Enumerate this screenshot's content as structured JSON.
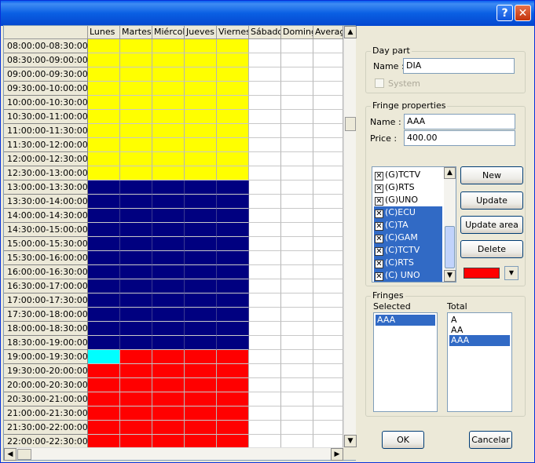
{
  "titlebar": {
    "help_glyph": "?",
    "close_glyph": "✕"
  },
  "grid": {
    "columns": [
      "Lunes",
      "Martes",
      "Miércol",
      "Jueves",
      "Viernes",
      "Sábado",
      "Doming",
      "Averag"
    ],
    "rows": [
      "08:00:00-08:30:00",
      "08:30:00-09:00:00",
      "09:00:00-09:30:00",
      "09:30:00-10:00:00",
      "10:00:00-10:30:00",
      "10:30:00-11:00:00",
      "11:00:00-11:30:00",
      "11:30:00-12:00:00",
      "12:00:00-12:30:00",
      "12:30:00-13:00:00",
      "13:00:00-13:30:00",
      "13:30:00-14:00:00",
      "14:00:00-14:30:00",
      "14:30:00-15:00:00",
      "15:00:00-15:30:00",
      "15:30:00-16:00:00",
      "16:00:00-16:30:00",
      "16:30:00-17:00:00",
      "17:00:00-17:30:00",
      "17:30:00-18:00:00",
      "18:00:00-18:30:00",
      "18:30:00-19:00:00",
      "19:00:00-19:30:00",
      "19:30:00-20:00:00",
      "20:00:00-20:30:00",
      "20:30:00-21:00:00",
      "21:00:00-21:30:00",
      "21:30:00-22:00:00",
      "22:00:00-22:30:00"
    ],
    "bands": [
      {
        "from": 0,
        "to": 9,
        "color": "#ffff00"
      },
      {
        "from": 10,
        "to": 21,
        "color": "#000080"
      },
      {
        "from": 22,
        "to": 28,
        "color": "#ff0000"
      }
    ],
    "colored_days": 5,
    "special_cell": {
      "row": 22,
      "col": 0,
      "color": "#00ffff"
    },
    "scroll_up": "▲",
    "scroll_down": "▼",
    "scroll_left": "◀",
    "scroll_right": "▶"
  },
  "day_part": {
    "title": "Day part",
    "name_label": "Name :",
    "name_value": "DIA",
    "system_label": "System"
  },
  "fringe_properties": {
    "title": "Fringe properties",
    "name_label": "Name :",
    "name_value": "AAA",
    "price_label": "Price :",
    "price_value": "400.00",
    "channels": [
      {
        "label": "(G)TCTV",
        "checked": true,
        "selected": false
      },
      {
        "label": "(G)RTS",
        "checked": true,
        "selected": false
      },
      {
        "label": "(G)UNO",
        "checked": true,
        "selected": false
      },
      {
        "label": "(C)ECU",
        "checked": true,
        "selected": true
      },
      {
        "label": "(C)TA",
        "checked": true,
        "selected": true
      },
      {
        "label": "(C)GAM",
        "checked": true,
        "selected": true
      },
      {
        "label": "(C)TCTV",
        "checked": true,
        "selected": true
      },
      {
        "label": "(C)RTS",
        "checked": true,
        "selected": true
      },
      {
        "label": "(C) UNO",
        "checked": true,
        "selected": true
      }
    ],
    "check_glyph": "⊠",
    "new_label": "New",
    "update_label": "Update",
    "update_area_label": "Update area",
    "delete_label": "Delete",
    "fringe_color": "#ff0000",
    "dropdown_glyph": "▼"
  },
  "fringes": {
    "title": "Fringes",
    "selected_label": "Selected",
    "total_label": "Total",
    "selected_items": [
      {
        "label": "AAA",
        "selected": true
      }
    ],
    "total_items": [
      {
        "label": "A",
        "selected": false
      },
      {
        "label": "AA",
        "selected": false
      },
      {
        "label": "AAA",
        "selected": true
      }
    ]
  },
  "footer": {
    "ok_label": "OK",
    "cancel_label": "Cancelar"
  }
}
